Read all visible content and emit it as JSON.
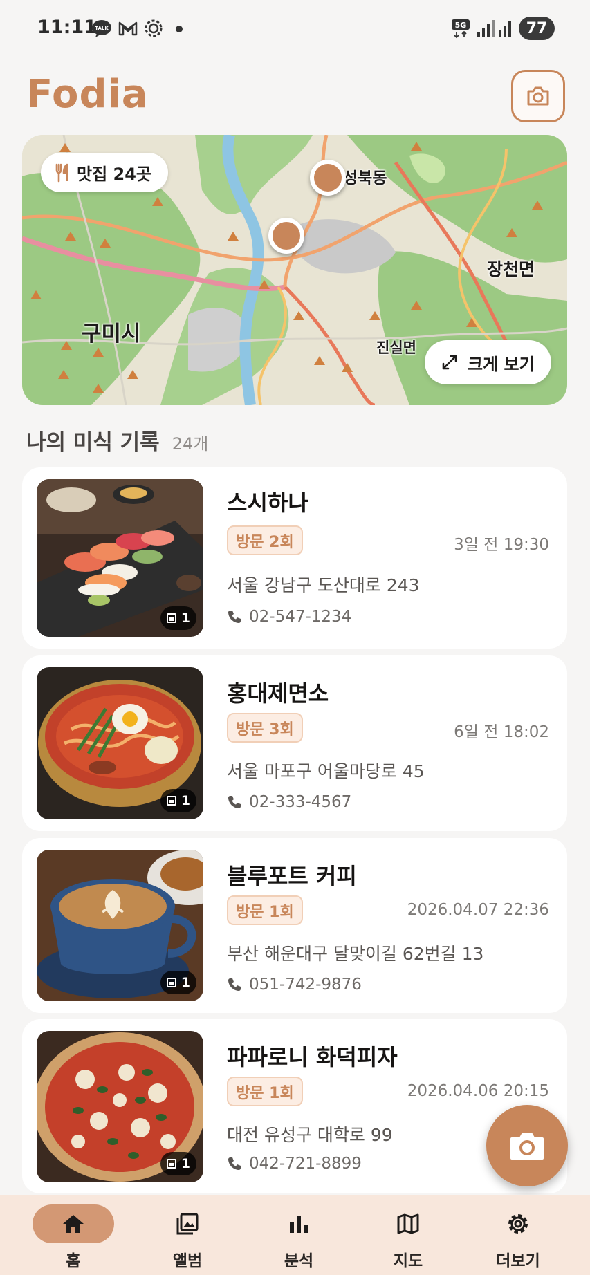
{
  "status_bar": {
    "time": "11:11",
    "icons": [
      "kakaotalk-icon",
      "gmail-icon",
      "settings-icon",
      "dot-icon",
      "5g-icon",
      "signal-icon",
      "signal-icon"
    ],
    "network": "5G",
    "battery": "77"
  },
  "header": {
    "title": "Fodia",
    "camera_icon": "camera-icon"
  },
  "map": {
    "count_label": "맛집 24곳",
    "count_icon": "fork-knife-icon",
    "expand_label": "크게 보기",
    "expand_icon": "expand-icon",
    "places": {
      "seongbuk": "성북동",
      "jangcheon": "장천면",
      "gumi": "구미시",
      "jinsil": "진실면"
    }
  },
  "section": {
    "title": "나의 미식 기록",
    "count": "24개"
  },
  "records": [
    {
      "name": "스시하나",
      "visits": "방문 2회",
      "time": "3일 전 19:30",
      "address": "서울 강남구 도산대로 243",
      "phone": "02-547-1234",
      "photos": "1"
    },
    {
      "name": "홍대제면소",
      "visits": "방문 3회",
      "time": "6일 전 18:02",
      "address": "서울 마포구 어울마당로 45",
      "phone": "02-333-4567",
      "photos": "1"
    },
    {
      "name": "블루포트 커피",
      "visits": "방문 1회",
      "time": "2026.04.07 22:36",
      "address": "부산 해운대구 달맞이길 62번길 13",
      "phone": "051-742-9876",
      "photos": "1"
    },
    {
      "name": "파파로니 화덕피자",
      "visits": "방문 1회",
      "time": "2026.04.06 20:15",
      "address": "대전 유성구 대학로 99",
      "phone": "042-721-8899",
      "photos": "1"
    }
  ],
  "fab": {
    "icon": "camera-icon"
  },
  "nav": [
    {
      "label": "홈",
      "icon": "home-icon",
      "active": true
    },
    {
      "label": "앨범",
      "icon": "album-icon",
      "active": false
    },
    {
      "label": "분석",
      "icon": "chart-icon",
      "active": false
    },
    {
      "label": "지도",
      "icon": "map-icon",
      "active": false
    },
    {
      "label": "더보기",
      "icon": "gear-icon",
      "active": false
    }
  ],
  "colors": {
    "accent": "#c8865a",
    "badge_bg": "#fcede3",
    "nav_bg": "#f8e7dc",
    "nav_active": "#d39874",
    "background": "#f6f5f4"
  }
}
